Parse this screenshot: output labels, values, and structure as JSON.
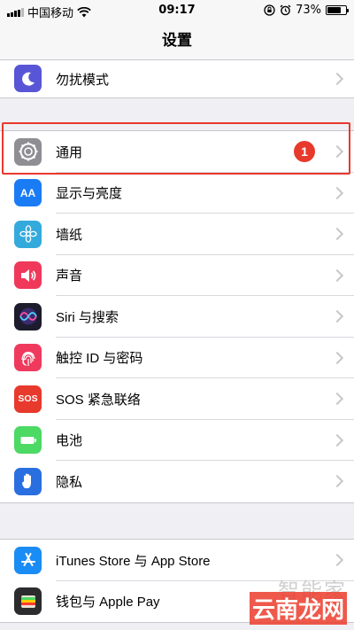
{
  "status_bar": {
    "carrier": "中国移动",
    "time": "09:17",
    "battery_percent": "73%",
    "battery_level": 0.73
  },
  "nav": {
    "title": "设置"
  },
  "rows": [
    {
      "label": "勿扰模式",
      "icon": "moon-icon",
      "color": "#5856d6"
    },
    {
      "label": "通用",
      "icon": "gear-icon",
      "color": "#8e8e93",
      "badge": "1"
    },
    {
      "label": "显示与亮度",
      "icon": "display-brightness-icon",
      "color": "#1a7cf5",
      "glyph": "AA"
    },
    {
      "label": "墙纸",
      "icon": "wallpaper-flower-icon",
      "color": "#34aadc"
    },
    {
      "label": "声音",
      "icon": "speaker-icon",
      "color": "#f0385b"
    },
    {
      "label": "Siri 与搜索",
      "icon": "siri-icon",
      "color": "#1c1c2e"
    },
    {
      "label": "触控 ID 与密码",
      "icon": "fingerprint-icon",
      "color": "#ef3a5d"
    },
    {
      "label": "SOS 紧急联络",
      "icon": "sos-icon",
      "color": "#e8392d",
      "glyph": "SOS"
    },
    {
      "label": "电池",
      "icon": "battery-icon",
      "color": "#4cd964"
    },
    {
      "label": "隐私",
      "icon": "hand-icon",
      "color": "#2a6fe0"
    },
    {
      "label": "iTunes Store 与 App Store",
      "icon": "app-store-icon",
      "color": "#1a8cf5"
    },
    {
      "label": "钱包与 Apple Pay",
      "icon": "wallet-icon",
      "color": "#2c2c2e"
    }
  ],
  "watermark": {
    "top": "智能家",
    "bottom": "云南龙网"
  },
  "colors": {
    "highlight": "#e8392d",
    "badge": "#e8392d"
  }
}
